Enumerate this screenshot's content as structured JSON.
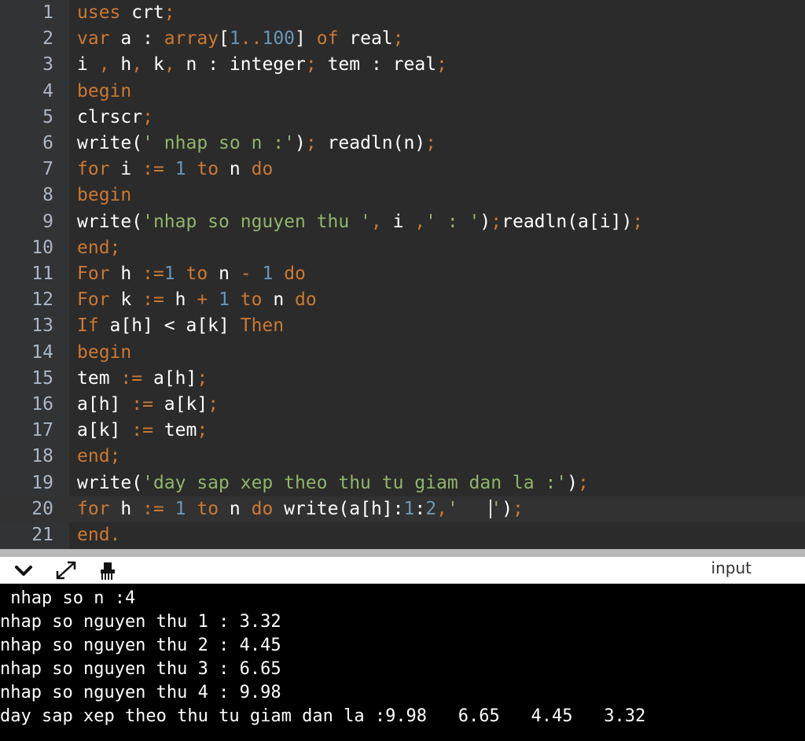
{
  "editor": {
    "lines": [
      {
        "n": "1",
        "tokens": [
          [
            "kw",
            "uses"
          ],
          [
            "id",
            " crt"
          ],
          [
            "op",
            ";"
          ]
        ]
      },
      {
        "n": "2",
        "tokens": [
          [
            "kw",
            "var"
          ],
          [
            "id",
            " a : "
          ],
          [
            "kw",
            "array"
          ],
          [
            "id",
            "["
          ],
          [
            "num",
            "1"
          ],
          [
            "kw",
            ".."
          ],
          [
            "num",
            "100"
          ],
          [
            "id",
            "] "
          ],
          [
            "kw",
            "of"
          ],
          [
            "id",
            " real"
          ],
          [
            "op",
            ";"
          ]
        ]
      },
      {
        "n": "3",
        "tokens": [
          [
            "id",
            "i "
          ],
          [
            "op",
            ","
          ],
          [
            "id",
            " h"
          ],
          [
            "op",
            ","
          ],
          [
            "id",
            " k"
          ],
          [
            "op",
            ","
          ],
          [
            "id",
            " n : integer"
          ],
          [
            "op",
            ";"
          ],
          [
            "id",
            " tem : real"
          ],
          [
            "op",
            ";"
          ]
        ]
      },
      {
        "n": "4",
        "tokens": [
          [
            "kw",
            "begin"
          ]
        ]
      },
      {
        "n": "5",
        "tokens": [
          [
            "id",
            "clrscr"
          ],
          [
            "op",
            ";"
          ]
        ]
      },
      {
        "n": "6",
        "tokens": [
          [
            "id",
            "write("
          ],
          [
            "str",
            "' nhap so n :'"
          ],
          [
            "id",
            ")"
          ],
          [
            "op",
            ";"
          ],
          [
            "id",
            " readln(n)"
          ],
          [
            "op",
            ";"
          ]
        ]
      },
      {
        "n": "7",
        "tokens": [
          [
            "kw",
            "for"
          ],
          [
            "id",
            " i "
          ],
          [
            "op",
            ":="
          ],
          [
            "id",
            " "
          ],
          [
            "num",
            "1"
          ],
          [
            "id",
            " "
          ],
          [
            "kw",
            "to"
          ],
          [
            "id",
            " n "
          ],
          [
            "kw",
            "do"
          ]
        ]
      },
      {
        "n": "8",
        "tokens": [
          [
            "kw",
            "begin"
          ]
        ]
      },
      {
        "n": "9",
        "tokens": [
          [
            "id",
            "write("
          ],
          [
            "str",
            "'nhap so nguyen thu '"
          ],
          [
            "op",
            ","
          ],
          [
            "id",
            " i "
          ],
          [
            "op",
            ","
          ],
          [
            "str",
            "' : '"
          ],
          [
            "id",
            ")"
          ],
          [
            "op",
            ";"
          ],
          [
            "id",
            "readln(a[i])"
          ],
          [
            "op",
            ";"
          ]
        ]
      },
      {
        "n": "10",
        "tokens": [
          [
            "kw",
            "end"
          ],
          [
            "op",
            ";"
          ]
        ]
      },
      {
        "n": "11",
        "tokens": [
          [
            "kw",
            "For"
          ],
          [
            "id",
            " h "
          ],
          [
            "op",
            ":="
          ],
          [
            "num",
            "1"
          ],
          [
            "id",
            " "
          ],
          [
            "kw",
            "to"
          ],
          [
            "id",
            " n "
          ],
          [
            "op",
            "-"
          ],
          [
            "id",
            " "
          ],
          [
            "num",
            "1"
          ],
          [
            "id",
            " "
          ],
          [
            "kw",
            "do"
          ]
        ]
      },
      {
        "n": "12",
        "tokens": [
          [
            "kw",
            "For"
          ],
          [
            "id",
            " k "
          ],
          [
            "op",
            ":="
          ],
          [
            "id",
            " h "
          ],
          [
            "op",
            "+"
          ],
          [
            "id",
            " "
          ],
          [
            "num",
            "1"
          ],
          [
            "id",
            " "
          ],
          [
            "kw",
            "to"
          ],
          [
            "id",
            " n "
          ],
          [
            "kw",
            "do"
          ]
        ]
      },
      {
        "n": "13",
        "tokens": [
          [
            "kw",
            "If"
          ],
          [
            "id",
            " a[h] < a[k] "
          ],
          [
            "kw",
            "Then"
          ]
        ]
      },
      {
        "n": "14",
        "tokens": [
          [
            "kw",
            "begin"
          ]
        ]
      },
      {
        "n": "15",
        "tokens": [
          [
            "id",
            "tem "
          ],
          [
            "op",
            ":="
          ],
          [
            "id",
            " a[h]"
          ],
          [
            "op",
            ";"
          ]
        ]
      },
      {
        "n": "16",
        "tokens": [
          [
            "id",
            "a[h] "
          ],
          [
            "op",
            ":="
          ],
          [
            "id",
            " a[k]"
          ],
          [
            "op",
            ";"
          ]
        ]
      },
      {
        "n": "17",
        "tokens": [
          [
            "id",
            "a[k] "
          ],
          [
            "op",
            ":="
          ],
          [
            "id",
            " tem"
          ],
          [
            "op",
            ";"
          ]
        ]
      },
      {
        "n": "18",
        "tokens": [
          [
            "kw",
            "end"
          ],
          [
            "op",
            ";"
          ]
        ]
      },
      {
        "n": "19",
        "tokens": [
          [
            "id",
            "write("
          ],
          [
            "str",
            "'day sap xep theo thu tu giam dan la :'"
          ],
          [
            "id",
            ")"
          ],
          [
            "op",
            ";"
          ]
        ]
      },
      {
        "n": "20",
        "active": true,
        "tokens": [
          [
            "kw",
            "for"
          ],
          [
            "id",
            " h "
          ],
          [
            "op",
            ":="
          ],
          [
            "id",
            " "
          ],
          [
            "num",
            "1"
          ],
          [
            "id",
            " "
          ],
          [
            "kw",
            "to"
          ],
          [
            "id",
            " n "
          ],
          [
            "kw",
            "do"
          ],
          [
            "id",
            " write(a[h]:"
          ],
          [
            "num",
            "1"
          ],
          [
            "id",
            ":"
          ],
          [
            "num",
            "2"
          ],
          [
            "op",
            ","
          ],
          [
            "str",
            "'   "
          ],
          [
            "caret",
            ""
          ],
          [
            "str",
            "'"
          ],
          [
            "id",
            ")"
          ],
          [
            "op",
            ";"
          ]
        ]
      },
      {
        "n": "21",
        "tokens": [
          [
            "kw",
            "end."
          ]
        ]
      }
    ]
  },
  "toolbar": {
    "collapse_icon": "chevron-down-icon",
    "expand_icon": "expand-icon",
    "clear_icon": "clear-icon",
    "input_label": "input"
  },
  "console": {
    "lines": [
      " nhap so n :4",
      "nhap so nguyen thu 1 : 3.32",
      "nhap so nguyen thu 2 : 4.45",
      "nhap so nguyen thu 3 : 6.65",
      "nhap so nguyen thu 4 : 9.98",
      "day sap xep theo thu tu giam dan la :9.98   6.65   4.45   3.32"
    ]
  },
  "colors": {
    "editor_bg": "#2b2b2b",
    "keyword": "#cc7832",
    "string": "#8fb56a",
    "number": "#6897bb",
    "console_bg": "#000000"
  }
}
